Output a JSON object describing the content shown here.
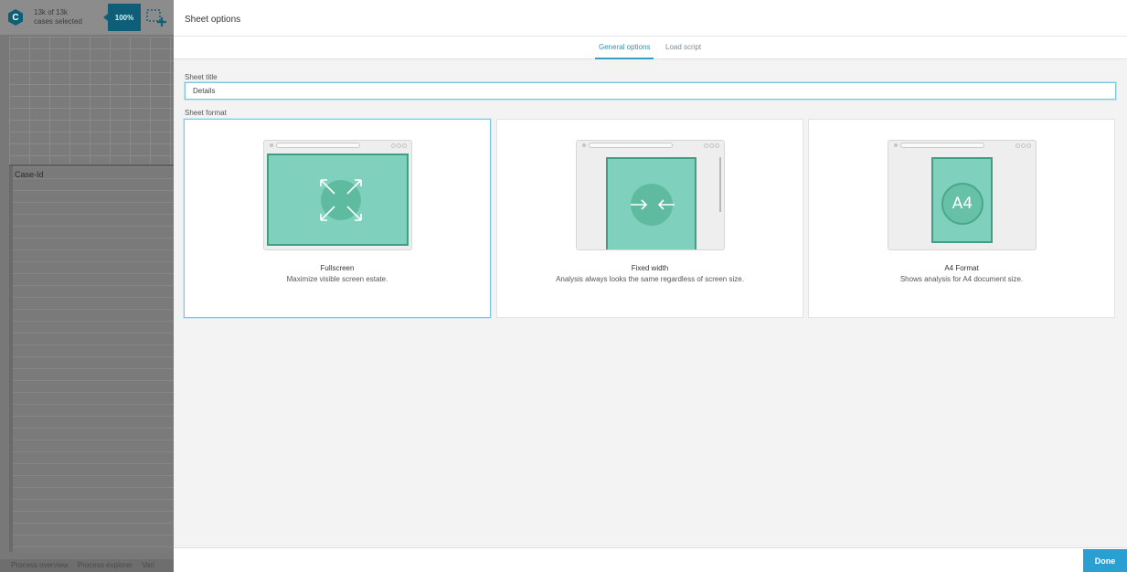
{
  "background_app": {
    "logo_letter": "C",
    "cases_count": "13k of 13k",
    "cases_label": "cases selected",
    "zoom_label": "100%",
    "column_header": "Case-Id",
    "bottom_tabs": [
      "Process overview",
      "Process explorer",
      "Vari"
    ]
  },
  "dialog": {
    "title": "Sheet options",
    "tabs": [
      {
        "label": "General options",
        "active": true
      },
      {
        "label": "Load script",
        "active": false
      }
    ],
    "sheet_title_label": "Sheet title",
    "sheet_title_value": "Details",
    "sheet_format_label": "Sheet format",
    "formats": [
      {
        "name": "Fullscreen",
        "description": "Maximize visible screen estate.",
        "selected": true
      },
      {
        "name": "Fixed width",
        "description": "Analysis always looks the same regardless of screen size.",
        "selected": false
      },
      {
        "name": "A4 Format",
        "description": "Shows analysis for A4 document size.",
        "selected": false,
        "badge": "A4"
      }
    ],
    "done_label": "Done"
  },
  "colors": {
    "accent": "#2aa0d2",
    "sheet_fill": "#7fd1bd",
    "sheet_border": "#3e9f85",
    "brand_dark": "#0e5e77"
  }
}
